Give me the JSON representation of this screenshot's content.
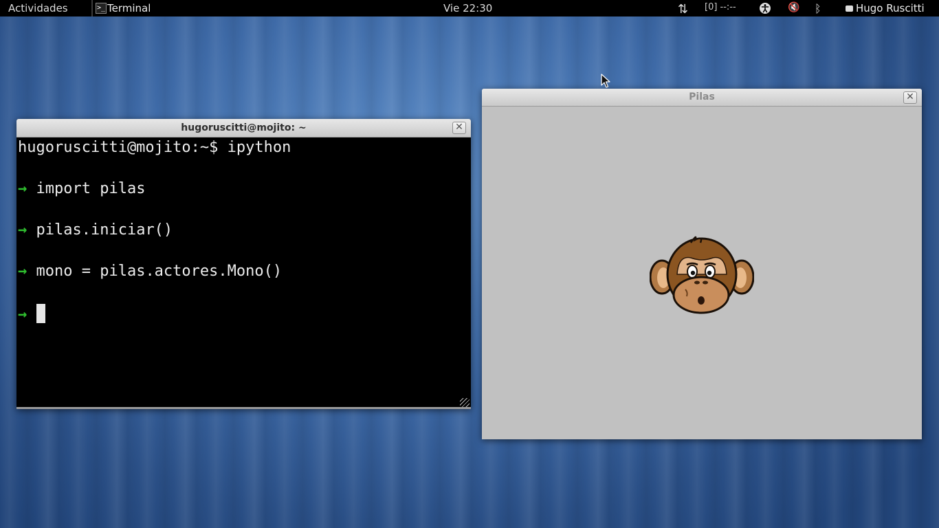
{
  "topbar": {
    "activities": "Actividades",
    "app_menu_label": "Terminal",
    "app_icon_glyph": ">_",
    "clock": "Vie 22:30",
    "network_glyph": "⇅",
    "battery": "[0] --:--",
    "bluetooth_glyph": "ᛒ",
    "volume_glyph": "🔇",
    "user": "Hugo Ruscitti"
  },
  "terminal": {
    "title": "hugoruscitti@mojito: ~",
    "close_glyph": "✕",
    "prompt_line": "hugoruscitti@mojito:~$ ipython",
    "arrow": "→",
    "lines": [
      "import pilas",
      "pilas.iniciar()",
      "mono = pilas.actores.Mono()"
    ]
  },
  "pilas_window": {
    "title": "Pilas",
    "close_glyph": "✕"
  },
  "colors": {
    "prompt_arrow": "#2fbd2f",
    "terminal_bg": "#000000",
    "pilas_canvas_bg": "#c1c1c1"
  }
}
